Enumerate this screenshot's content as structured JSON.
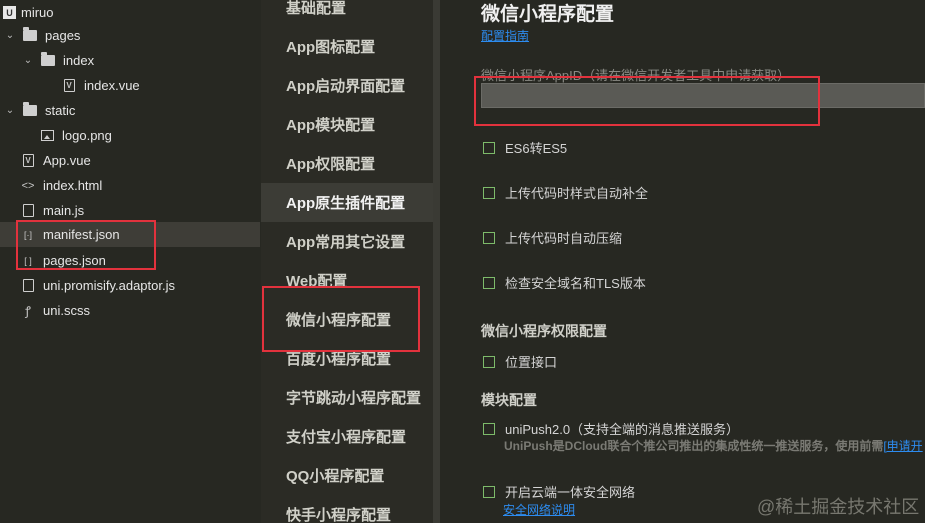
{
  "tree": {
    "items": [
      {
        "label": "miruo",
        "icon": "app-logo-icon"
      },
      {
        "label": "pages",
        "icon": "folder-icon"
      },
      {
        "label": "index",
        "icon": "folder-icon"
      },
      {
        "label": "index.vue",
        "icon": "vue-file-icon"
      },
      {
        "label": "static",
        "icon": "folder-icon"
      },
      {
        "label": "logo.png",
        "icon": "image-file-icon"
      },
      {
        "label": "App.vue",
        "icon": "vue-file-icon"
      },
      {
        "label": "index.html",
        "icon": "html-file-icon"
      },
      {
        "label": "main.js",
        "icon": "js-file-icon"
      },
      {
        "label": "manifest.json",
        "icon": "json-file-icon"
      },
      {
        "label": "pages.json",
        "icon": "json-file-icon"
      },
      {
        "label": "uni.promisify.adaptor.js",
        "icon": "js-file-icon"
      },
      {
        "label": "uni.scss",
        "icon": "scss-file-icon"
      }
    ]
  },
  "nav": {
    "items": [
      "基础配置",
      "App图标配置",
      "App启动界面配置",
      "App模块配置",
      "App权限配置",
      "App原生插件配置",
      "App常用其它设置",
      "Web配置",
      "微信小程序配置",
      "百度小程序配置",
      "字节跳动小程序配置",
      "支付宝小程序配置",
      "QQ小程序配置",
      "快手小程序配置"
    ],
    "active_index": 5
  },
  "main": {
    "title": "微信小程序配置",
    "guide_link": "配置指南",
    "appid_label": "微信小程序AppID（请在微信开发者工具中申请获取）",
    "appid_value": "",
    "options": [
      "ES6转ES5",
      "上传代码时样式自动补全",
      "上传代码时自动压缩",
      "检查安全域名和TLS版本"
    ],
    "permission_section": "微信小程序权限配置",
    "permission_option": "位置接口",
    "module_section": "模块配置",
    "unipush_label": "uniPush2.0（支持全端的消息推送服务）",
    "unipush_desc": "UniPush是DCloud联合个推公司推出的集成性统一推送服务，使用前需",
    "unipush_link": "[申请开",
    "secure_label": "开启云端一体安全网络",
    "secure_link": "安全网络说明"
  },
  "watermark": "@稀土掘金技术社区",
  "colors": {
    "accent_link": "#2d8cf0",
    "highlight_box": "#e2323d",
    "checkbox_border": "#7dbb6a"
  }
}
